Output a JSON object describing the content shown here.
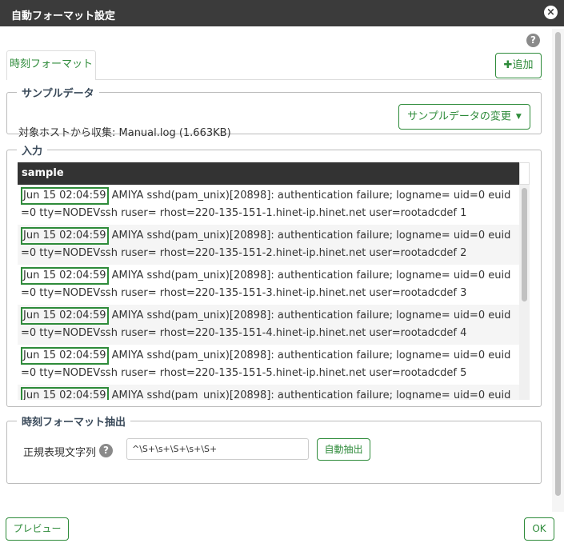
{
  "dialog": {
    "title": "自動フォーマット設定",
    "close_icon": "×"
  },
  "help_icon": "?",
  "tabs": [
    {
      "label": "時刻フォーマット"
    }
  ],
  "toolbar": {
    "add_plus": "✚",
    "add_label": "追加"
  },
  "sample_data": {
    "legend": "サンプルデータ",
    "text": "対象ホストから収集: Manual.log (1.663KB)",
    "change_button": "サンプルデータの変更",
    "caret": "▼"
  },
  "input": {
    "legend": "入力",
    "column_header": "sample",
    "rows": [
      {
        "timestamp": "Jun 15 02:04:59",
        "rest": " AMIYA sshd(pam_unix)[20898]: authentication failure; logname= uid=0 euid=0 tty=NODEVssh ruser= rhost=220-135-151-1.hinet-ip.hinet.net  user=rootadcdef 1"
      },
      {
        "timestamp": "Jun 15 02:04:59",
        "rest": " AMIYA sshd(pam_unix)[20898]: authentication failure; logname= uid=0 euid=0 tty=NODEVssh ruser= rhost=220-135-151-2.hinet-ip.hinet.net  user=rootadcdef 2"
      },
      {
        "timestamp": "Jun 15 02:04:59",
        "rest": " AMIYA sshd(pam_unix)[20898]: authentication failure; logname= uid=0 euid=0 tty=NODEVssh ruser= rhost=220-135-151-3.hinet-ip.hinet.net  user=rootadcdef 3"
      },
      {
        "timestamp": "Jun 15 02:04:59",
        "rest": " AMIYA sshd(pam_unix)[20898]: authentication failure; logname= uid=0 euid=0 tty=NODEVssh ruser= rhost=220-135-151-4.hinet-ip.hinet.net  user=rootadcdef 4"
      },
      {
        "timestamp": "Jun 15 02:04:59",
        "rest": " AMIYA sshd(pam_unix)[20898]: authentication failure; logname= uid=0 euid=0 tty=NODEVssh ruser= rhost=220-135-151-5.hinet-ip.hinet.net  user=rootadcdef 5"
      },
      {
        "timestamp": "Jun 15 02:04:59",
        "rest": " AMIYA sshd(pam_unix)[20898]: authentication failure; logname= uid=0 euid="
      }
    ]
  },
  "extract": {
    "legend": "時刻フォーマット抽出",
    "regex_label": "正規表現文字列",
    "regex_value": "^\\S+\\s+\\S+\\s+\\S+",
    "auto_button": "自動抽出"
  },
  "footer": {
    "preview_button": "プレビュー",
    "ok_button": "OK"
  },
  "colors": {
    "accent": "#2e8b3a",
    "titlebar": "#3b3b3b",
    "table_header": "#333333"
  }
}
